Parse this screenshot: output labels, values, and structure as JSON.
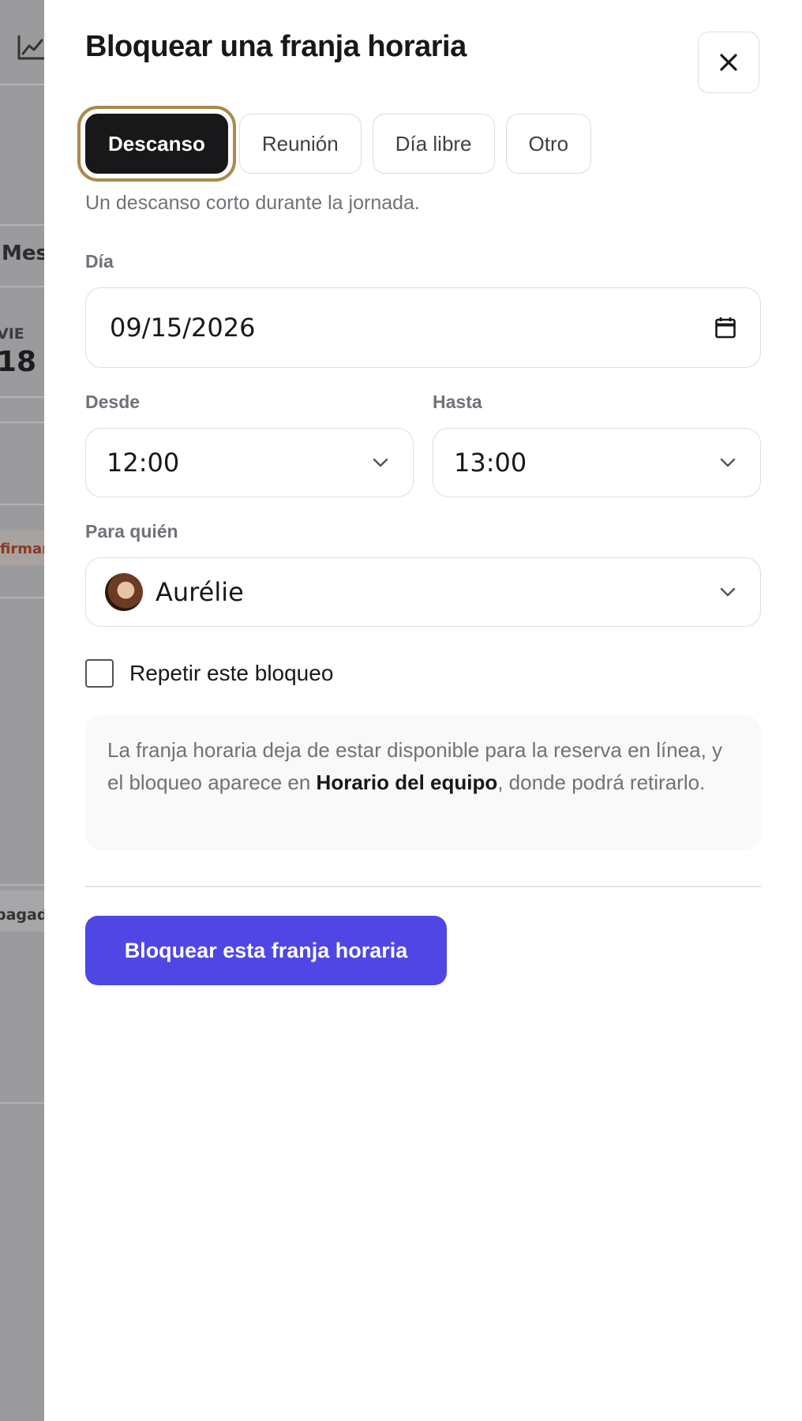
{
  "background": {
    "view_label": "Mes",
    "day_abbr": "VIE",
    "day_number": "18",
    "status_confirm": "firmar",
    "status_paid": "pagado"
  },
  "dialog": {
    "title": "Bloquear una franja horaria",
    "close_icon": "close-icon",
    "types": [
      {
        "label": "Descanso",
        "selected": true
      },
      {
        "label": "Reunión",
        "selected": false
      },
      {
        "label": "Día libre",
        "selected": false
      },
      {
        "label": "Otro",
        "selected": false
      }
    ],
    "type_hint": "Un descanso corto durante la jornada.",
    "day": {
      "label": "Día",
      "value": "09/15/2026"
    },
    "from": {
      "label": "Desde",
      "value": "12:00"
    },
    "to": {
      "label": "Hasta",
      "value": "13:00"
    },
    "for_whom": {
      "label": "Para quién",
      "value": "Aurélie"
    },
    "repeat": {
      "label": "Repetir este bloqueo",
      "checked": false
    },
    "note": {
      "before": "La franja horaria deja de estar disponible para la reserva en línea, y el bloqueo aparece en ",
      "emphasis": "Horario del equipo",
      "after": ", donde podrá retirarlo."
    },
    "submit_label": "Bloquear esta franja horaria",
    "colors": {
      "primary": "#4f46e5",
      "selected_segment": "#18181b",
      "focus_ring": "#a88a4b"
    }
  }
}
